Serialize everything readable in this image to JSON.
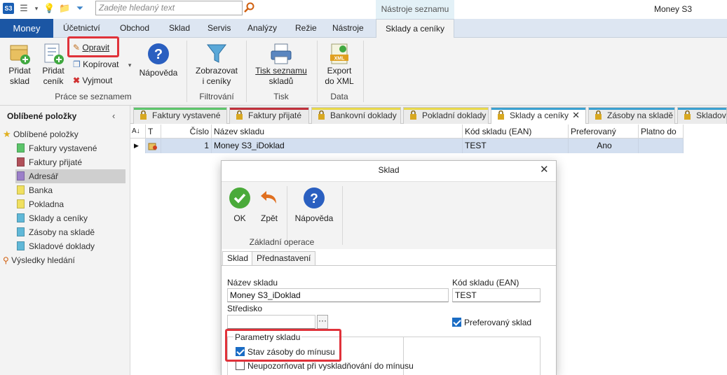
{
  "titlebar": {
    "search_placeholder": "Zadejte hledaný text",
    "context_group": "Nástroje seznamu",
    "app_title": "Money S3"
  },
  "menu": {
    "money": "Money",
    "tabs": [
      "Účetnictví",
      "Obchod",
      "Sklad",
      "Servis",
      "Analýzy",
      "Režie",
      "Nástroje"
    ],
    "active_tab": "Sklady a ceníky"
  },
  "ribbon": {
    "add_warehouse": [
      "Přidat",
      "sklad"
    ],
    "add_pricelist": [
      "Přidat",
      "ceník"
    ],
    "edit": "Opravit",
    "copy": "Kopírovat",
    "cut": "Vyjmout",
    "help": "Nápověda",
    "group_list": "Práce se seznamem",
    "show_pricelists": [
      "Zobrazovat",
      "i ceníky"
    ],
    "group_filter": "Filtrování",
    "print_list": [
      "Tisk seznamu",
      "skladů"
    ],
    "group_print": "Tisk",
    "export_xml": [
      "Export",
      "do XML"
    ],
    "group_data": "Data"
  },
  "sidebar": {
    "title": "Oblíbené položky",
    "root": "Oblíbené položky",
    "items": [
      {
        "label": "Faktury vystavené",
        "color": "#5cc46a"
      },
      {
        "label": "Faktury přijaté",
        "color": "#b0505a"
      },
      {
        "label": "Adresář",
        "color": "#9b7fc9"
      },
      {
        "label": "Banka",
        "color": "#f0e060"
      },
      {
        "label": "Pokladna",
        "color": "#f0e060"
      },
      {
        "label": "Sklady a ceníky",
        "color": "#60b8d8"
      },
      {
        "label": "Zásoby na skladě",
        "color": "#60b8d8"
      },
      {
        "label": "Skladové doklady",
        "color": "#60b8d8"
      }
    ],
    "search_results": "Výsledky hledání"
  },
  "doc_tabs": [
    {
      "label": "Faktury vystavené",
      "color": "#5cc46a"
    },
    {
      "label": "Faktury přijaté",
      "color": "#c0303a"
    },
    {
      "label": "Bankovní doklady",
      "color": "#e8d84a"
    },
    {
      "label": "Pokladní doklady",
      "color": "#e8d84a"
    },
    {
      "label": "Sklady a ceníky",
      "color": "#3aa0d0"
    },
    {
      "label": "Zásoby na skladě",
      "color": "#3aa0d0"
    },
    {
      "label": "Skladové",
      "color": "#3aa0d0"
    }
  ],
  "grid": {
    "headers": [
      "T",
      "Číslo",
      "Název skladu",
      "Kód skladu (EAN)",
      "Preferovaný sklad",
      "Platno do"
    ],
    "row": {
      "number": "1",
      "name": "Money S3_iDoklad",
      "code": "TEST",
      "preferred": "Ano",
      "valid": ""
    }
  },
  "dialog": {
    "title": "Sklad",
    "ok": "OK",
    "back": "Zpět",
    "help": "Nápověda",
    "group": "Základní operace",
    "tabs": [
      "Sklad",
      "Přednastavení"
    ],
    "name_label": "Název skladu",
    "name_value": "Money S3_iDoklad",
    "code_label": "Kód skladu (EAN)",
    "code_value": "TEST",
    "center_label": "Středisko",
    "center_value": "",
    "preferred_label": "Preferovaný sklad",
    "params_group": "Parametry skladu",
    "negative_stock": "Stav zásoby do mínusu",
    "no_warn": "Neupozorňovat při vyskladňování do mínusu"
  }
}
